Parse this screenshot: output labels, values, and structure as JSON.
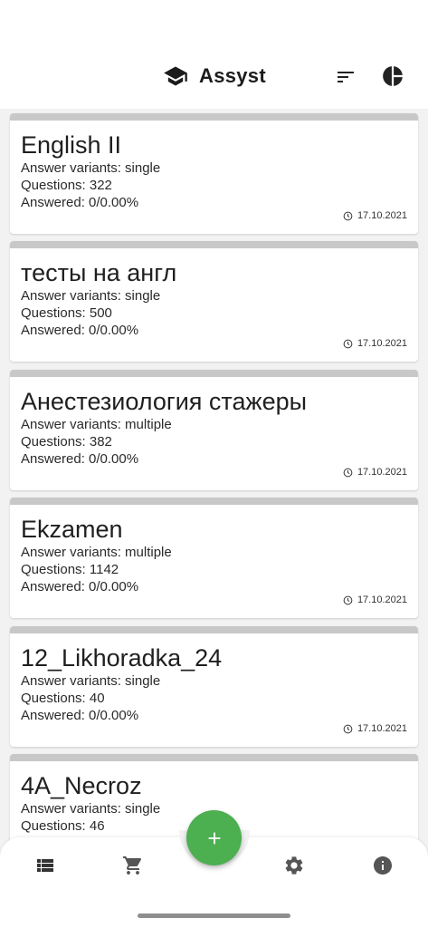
{
  "app": {
    "title": "Assyst",
    "icons": {
      "logo": "graduation-cap-icon",
      "sort": "sort-icon",
      "stats": "pie-chart-icon"
    }
  },
  "tests": [
    {
      "title": "English II",
      "variants": "Answer variants: single",
      "questions": "Questions: 322",
      "answered": "Answered: 0/0.00%",
      "date": "17.10.2021"
    },
    {
      "title": "тесты на англ",
      "variants": "Answer variants: single",
      "questions": "Questions: 500",
      "answered": "Answered: 0/0.00%",
      "date": "17.10.2021"
    },
    {
      "title": "Анестезиология стажеры",
      "variants": "Answer variants: multiple",
      "questions": "Questions: 382",
      "answered": "Answered: 0/0.00%",
      "date": "17.10.2021"
    },
    {
      "title": "Ekzamen",
      "variants": "Answer variants: multiple",
      "questions": "Questions: 1142",
      "answered": "Answered: 0/0.00%",
      "date": "17.10.2021"
    },
    {
      "title": "12_Likhoradka_24",
      "variants": "Answer variants: single",
      "questions": "Questions: 40",
      "answered": "Answered: 0/0.00%",
      "date": "17.10.2021"
    },
    {
      "title": "4A_Necroz",
      "variants": "Answer variants: single",
      "questions": "Questions: 46",
      "answered": "",
      "date": ""
    }
  ],
  "bottom_nav": {
    "items": [
      "list-icon",
      "cart-icon",
      "settings-icon",
      "info-icon"
    ],
    "fab_icon": "plus-icon"
  },
  "colors": {
    "accent": "#4caf50",
    "card_strip": "#c8c8c8",
    "icon": "#333333",
    "nav_icon": "#555555"
  }
}
